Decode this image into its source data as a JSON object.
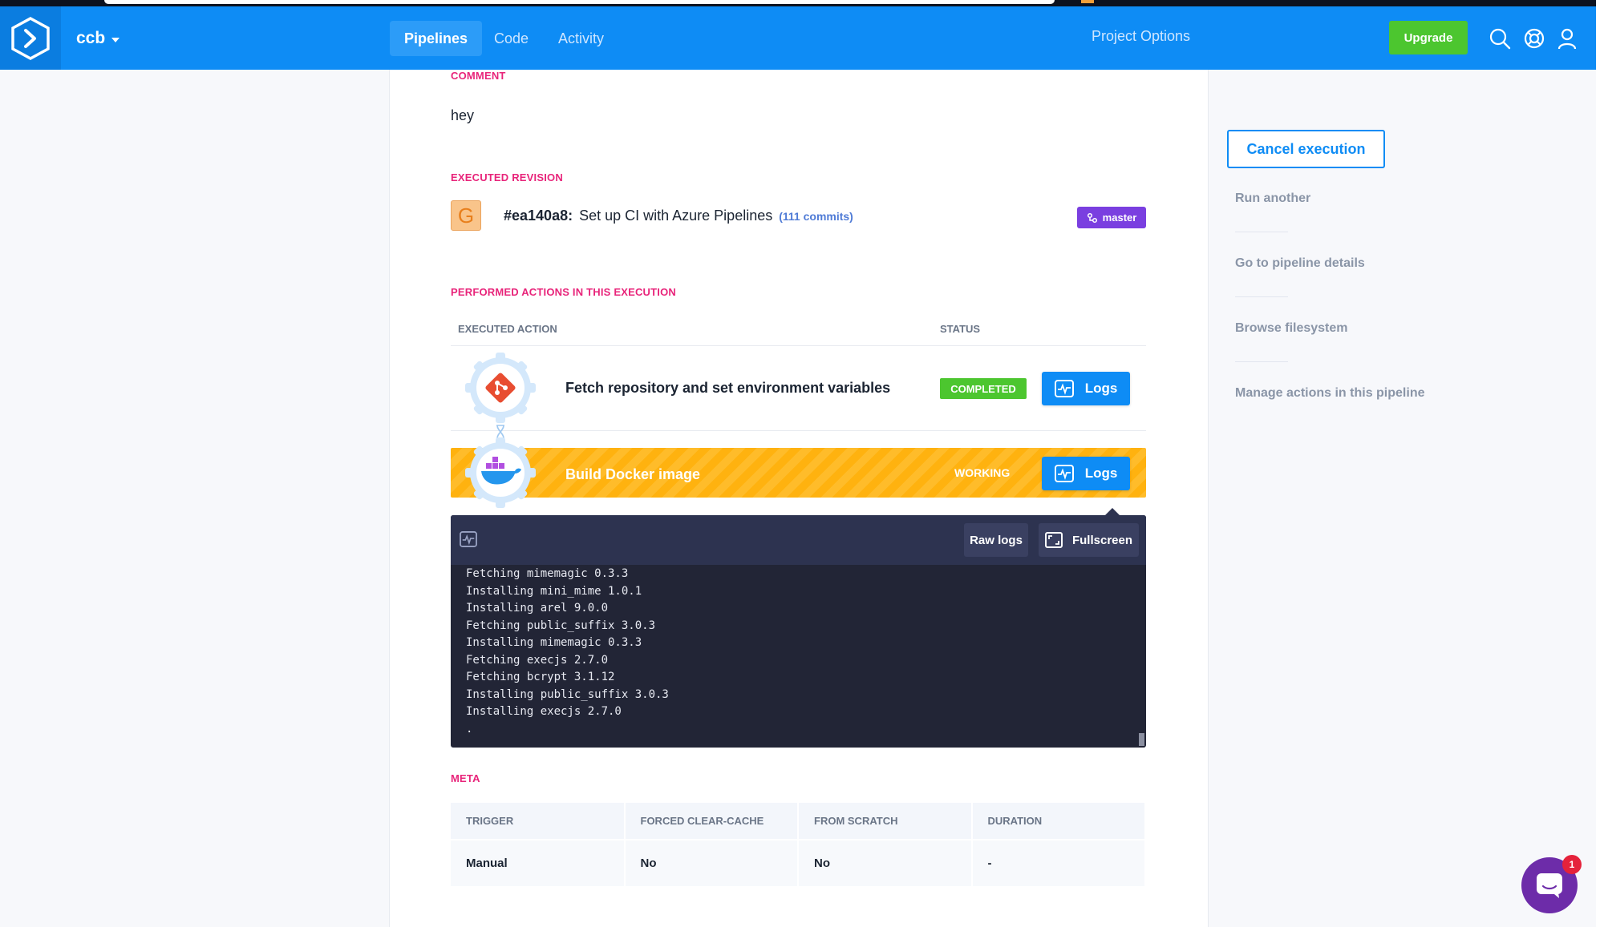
{
  "nav": {
    "project": "ccb",
    "tabs": [
      {
        "label": "Pipelines",
        "active": true
      },
      {
        "label": "Code",
        "active": false
      },
      {
        "label": "Activity",
        "active": false
      }
    ],
    "project_options": "Project Options",
    "upgrade": "Upgrade",
    "icons": [
      "search-icon",
      "help-icon",
      "user-icon"
    ]
  },
  "comment": {
    "title": "COMMENT",
    "text": "hey"
  },
  "revision": {
    "title": "EXECUTED REVISION",
    "avatar": "G",
    "hash": "#ea140a8:",
    "message": "Set up CI with Azure Pipelines",
    "commits": "(111 commits)",
    "branch": "master"
  },
  "actions": {
    "title": "PERFORMED ACTIONS IN THIS EXECUTION",
    "col_action": "EXECUTED ACTION",
    "col_status": "STATUS",
    "rows": [
      {
        "name": "Fetch repository and set environment variables",
        "status": "COMPLETED",
        "logs": "Logs"
      },
      {
        "name": "Build Docker image",
        "status": "WORKING",
        "logs": "Logs"
      }
    ]
  },
  "log": {
    "raw": "Raw logs",
    "fullscreen": "Fullscreen",
    "lines": [
      "Fetching mimemagic 0.3.3",
      "Installing mini_mime 1.0.1",
      "Installing arel 9.0.0",
      "Fetching public_suffix 3.0.3",
      "Installing mimemagic 0.3.3",
      "Fetching execjs 2.7.0",
      "Fetching bcrypt 3.1.12",
      "Installing public_suffix 3.0.3",
      "Installing execjs 2.7.0",
      "."
    ]
  },
  "meta": {
    "title": "META",
    "headers": [
      "TRIGGER",
      "FORCED CLEAR-CACHE",
      "FROM SCRATCH",
      "DURATION"
    ],
    "values": [
      "Manual",
      "No",
      "No",
      "-"
    ]
  },
  "sidebar": {
    "cancel": "Cancel execution",
    "links": [
      "Run another",
      "Go to pipeline details",
      "Browse filesystem",
      "Manage actions in this pipeline"
    ]
  },
  "chat": {
    "badge": "1"
  },
  "colors": {
    "primary": "#0e8cf5",
    "accent_pink": "#e8247a",
    "success": "#4cc62f",
    "working": "#ffb20f",
    "branch": "#7a3fe0"
  }
}
